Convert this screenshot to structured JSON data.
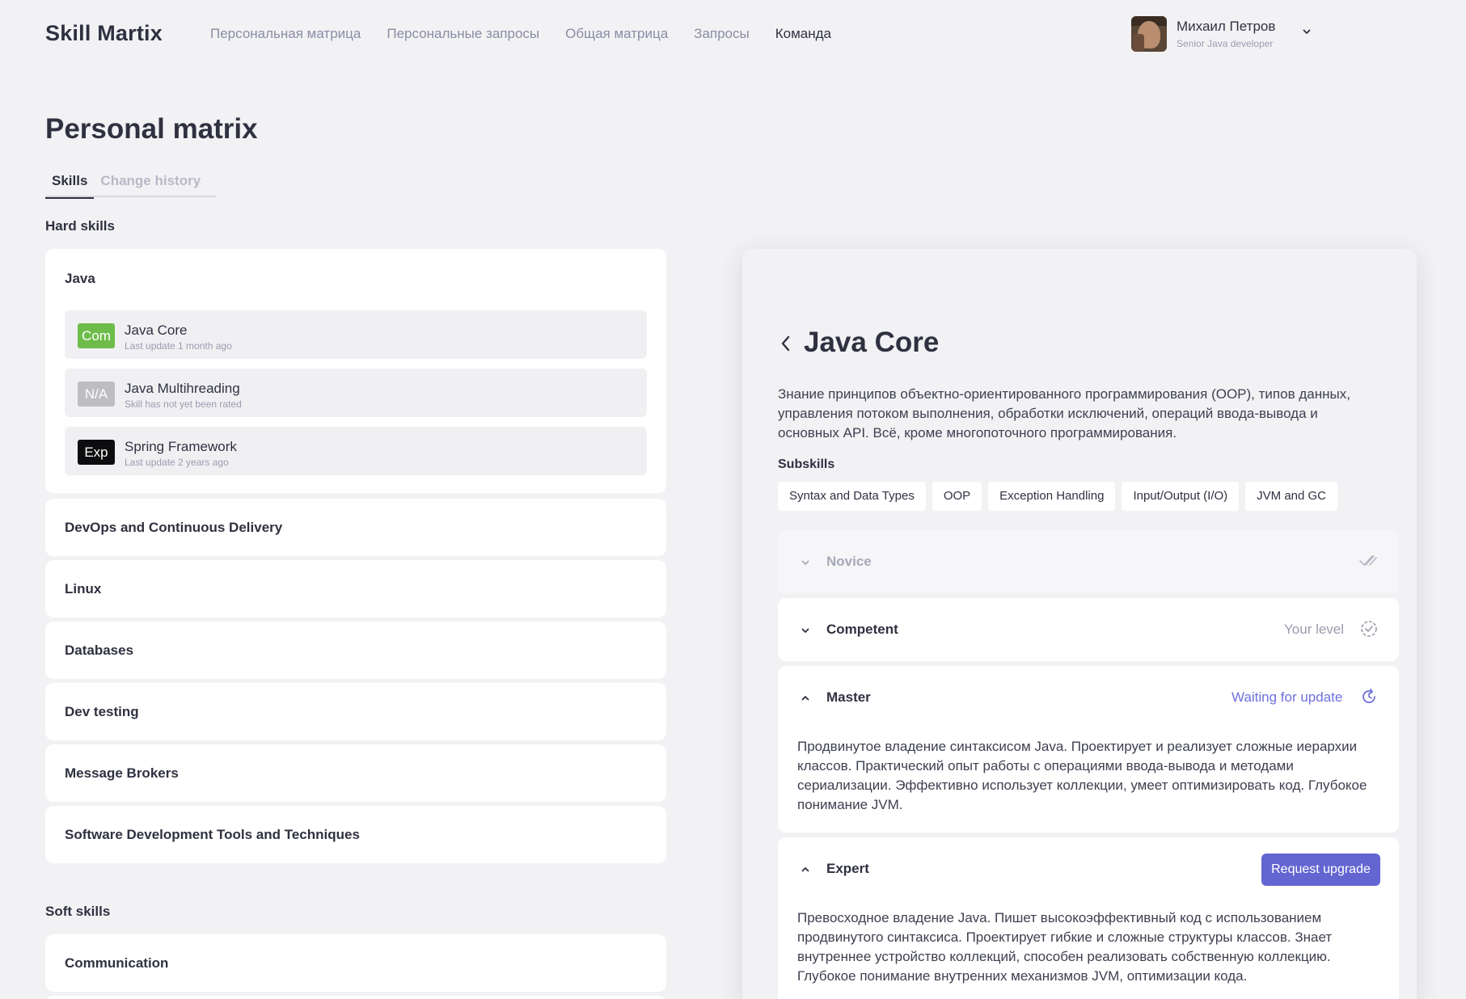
{
  "app": {
    "logo": "Skill Martix"
  },
  "nav": [
    {
      "label": "Персональная матрица",
      "active": false
    },
    {
      "label": "Персональные запросы",
      "active": false
    },
    {
      "label": "Общая матрица",
      "active": false
    },
    {
      "label": "Запросы",
      "active": false
    },
    {
      "label": "Команда",
      "active": true
    }
  ],
  "user": {
    "name": "Михаил Петров",
    "role": "Senior Java developer",
    "icons": [
      "avatar",
      "chevron-down-icon"
    ]
  },
  "page": {
    "title": "Personal matrix",
    "tabs": [
      {
        "label": "Skills",
        "active": true
      },
      {
        "label": "Change history",
        "active": false
      }
    ]
  },
  "hard_skills": {
    "label": "Hard skills",
    "groups": [
      {
        "title": "Java",
        "expanded": true,
        "skills": [
          {
            "badge": "Com",
            "badge_color": "#6ebd4a",
            "name": "Java Core",
            "subtitle": "Last update 1 month ago"
          },
          {
            "badge": "N/A",
            "badge_color": "#bdbdc2",
            "name": "Java Multihreading",
            "subtitle": "Skill has not yet been rated"
          },
          {
            "badge": "Exp",
            "badge_color": "#0d0d0f",
            "name": "Spring Framework",
            "subtitle": "Last update 2 years ago"
          }
        ]
      },
      {
        "title": "DevOps and Continuous Delivery",
        "expanded": false
      },
      {
        "title": "Linux",
        "expanded": false
      },
      {
        "title": "Databases",
        "expanded": false
      },
      {
        "title": "Dev testing",
        "expanded": false
      },
      {
        "title": "Message Brokers",
        "expanded": false
      },
      {
        "title": "Software Development Tools and Techniques",
        "expanded": false
      }
    ]
  },
  "soft_skills": {
    "label": "Soft skills",
    "groups": [
      {
        "title": "Communication",
        "expanded": false
      }
    ]
  },
  "detail": {
    "title": "Java Core",
    "description": "Знание принципов объектно-ориентированного программирования (OOP), типов данных, управления потоком выполнения, обработки исключений, операций ввода-вывода и основных API. Всё, кроме многопоточного программирования.",
    "subskills_label": "Subskills",
    "subskills": [
      "Syntax and Data Types",
      "OOP",
      "Exception Handling",
      "Input/Output (I/O)",
      "JVM and GC"
    ],
    "levels": [
      {
        "name": "Novice",
        "state": "collapsed",
        "status": "",
        "icon": "double-check-icon"
      },
      {
        "name": "Competent",
        "state": "collapsed",
        "status": "Your level",
        "icon": "check-badge-icon"
      },
      {
        "name": "Master",
        "state": "expanded",
        "status": "Waiting for update",
        "icon": "refresh-icon",
        "text": "Продвинутое владение синтаксисом Java. Проектирует и реализует сложные иерархии классов. Практический опыт работы с операциями ввода-вывода и методами сериализации. Эффективно использует коллекции, умеет оптимизировать код. Глубокое понимание JVM."
      },
      {
        "name": "Expert",
        "state": "expanded",
        "button": "Request upgrade",
        "text": "Превосходное владение Java. Пишет высокоэффективный код с использованием продвинутого синтаксиса. Проектирует гибкие и сложные структуры классов. Знает внутреннее устройство коллекций, способен реализовать собственную коллекцию. Глубокое понимание внутренних механизмов JVM, оптимизации кода."
      }
    ]
  },
  "colors": {
    "accent": "#6366d1",
    "waiting": "#6d70d9",
    "background": "#f2f2f5",
    "text": "#2f3140"
  }
}
